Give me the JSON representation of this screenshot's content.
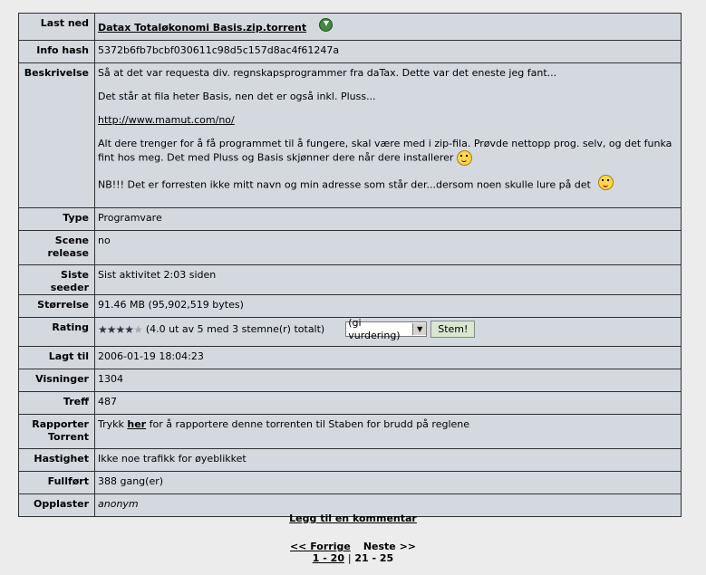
{
  "details": {
    "last_ned": {
      "label": "Last ned",
      "value": "Datax Totaløkonomi Basis.zip.torrent",
      "icon": "download-icon"
    },
    "info_hash": {
      "label": "Info hash",
      "value": "5372b6fb7bcbf030611c98d5c157d8ac4f61247a"
    },
    "beskrivelse": {
      "label": "Beskrivelse",
      "line1": "Så at det var requesta div. regnskapsprogrammer fra daTax. Dette var det eneste jeg fant...",
      "line2": "Det står at fila heter Basis, nen det er også inkl. Pluss...",
      "url": "http://www.mamut.com/no/",
      "line4": "Alt dere trenger for å få programmet til å fungere, skal være med i zip-fila. Prøvde nettopp prog. selv, og det funka fint hos meg. Det med Pluss og Basis skjønner dere når dere installerer",
      "line5": "NB!!! Det er forresten ikke mitt navn og min adresse som står der...dersom noen skulle lure på det"
    },
    "type": {
      "label": "Type",
      "value": "Programvare"
    },
    "scene": {
      "label": "Scene release",
      "value": "no"
    },
    "siste_seeder": {
      "label": "Siste seeder",
      "value": "Sist aktivitet 2:03 siden"
    },
    "storrelse": {
      "label": "Størrelse",
      "value": "91.46 MB (95,902,519 bytes)"
    },
    "rating": {
      "label": "Rating",
      "stars_filled": 4,
      "stars_total": 5,
      "text": "(4.0 ut av 5 med 3 stemne(r) totalt)",
      "select_value": "(gi vurdering)",
      "vote_label": "Stem!"
    },
    "lagt_til": {
      "label": "Lagt til",
      "value": "2006-01-19 18:04:23"
    },
    "visninger": {
      "label": "Visninger",
      "value": "1304"
    },
    "treff": {
      "label": "Treff",
      "value": "487"
    },
    "rapporter": {
      "label": "Rapporter Torrent",
      "pre": "Trykk ",
      "link": "her",
      "post": " for å rapportere denne torrenten til Staben for brudd på reglene"
    },
    "hastighet": {
      "label": "Hastighet",
      "value": "Ikke noe trafikk for øyeblikket"
    },
    "fullfort": {
      "label": "Fullført",
      "value": "388 gang(er)"
    },
    "opplaster": {
      "label": "Opplaster",
      "value": "anonym"
    }
  },
  "footer": {
    "add_comment": "Legg til en kommentar",
    "prev": "<< Forrige",
    "next": "Neste >>",
    "page_current": "1 - 20",
    "separator": "|",
    "page_other": "21 - 25"
  },
  "colors": {
    "table_bg": "#d4d9e0",
    "page_bg": "#ececec",
    "border": "#303030"
  }
}
